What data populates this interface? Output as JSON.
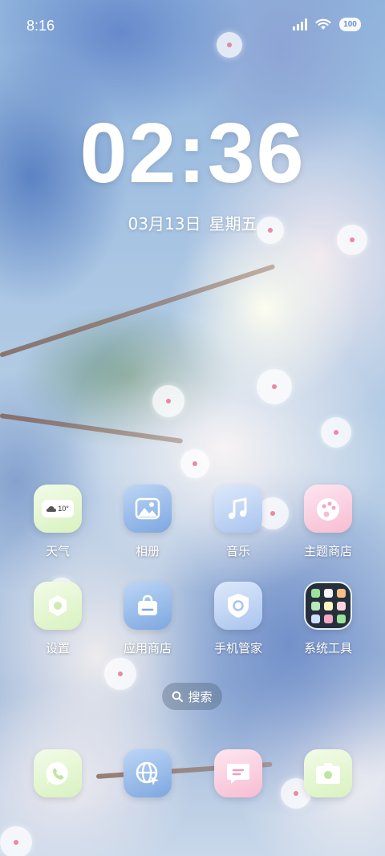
{
  "status_bar": {
    "time": "8:16",
    "battery_level": "100",
    "icons": [
      "signal-icon",
      "wifi-icon",
      "battery-icon"
    ]
  },
  "lock_clock": {
    "time": "02:36",
    "date": "03月13日",
    "weekday": "星期五"
  },
  "apps": [
    {
      "label": "天气",
      "icon": "weather-icon",
      "widget_text": "10°",
      "color": "#d9f2c1"
    },
    {
      "label": "相册",
      "icon": "gallery-icon",
      "color": "#7ea7e0"
    },
    {
      "label": "音乐",
      "icon": "music-icon",
      "color": "#a9c4ee"
    },
    {
      "label": "主题商店",
      "icon": "theme-store-icon",
      "color": "#f7bdd2"
    },
    {
      "label": "设置",
      "icon": "settings-icon",
      "color": "#d9f2c1"
    },
    {
      "label": "应用商店",
      "icon": "app-store-icon",
      "color": "#7ea7e0"
    },
    {
      "label": "手机管家",
      "icon": "phone-manager-icon",
      "color": "#a9c4ee"
    },
    {
      "label": "系统工具",
      "icon": "folder-icon",
      "color": "#26303d"
    }
  ],
  "search": {
    "label": "搜索",
    "icon": "search-icon"
  },
  "dock": [
    {
      "name": "phone",
      "icon": "phone-icon",
      "color": "#d9f2c1"
    },
    {
      "name": "browser",
      "icon": "browser-icon",
      "color": "#7ea7e0"
    },
    {
      "name": "messages",
      "icon": "message-icon",
      "color": "#f7bdd2"
    },
    {
      "name": "camera",
      "icon": "camera-icon",
      "color": "#d9f2c1"
    }
  ]
}
